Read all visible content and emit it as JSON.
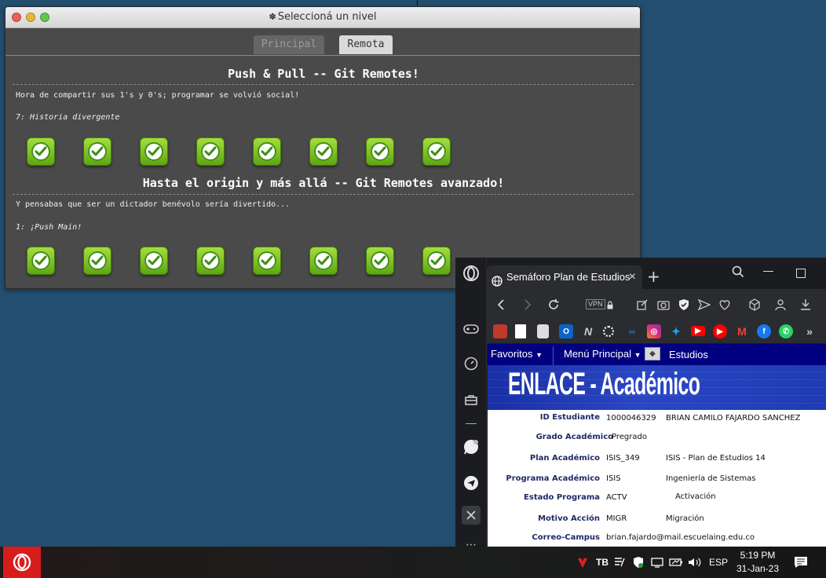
{
  "game": {
    "window_title": "Seleccioná un nivel",
    "tabs": [
      {
        "label": "Principal"
      },
      {
        "label": "Remota"
      }
    ],
    "sections": [
      {
        "title": "Push & Pull -- Git Remotes!",
        "description": "Hora de compartir sus 1's y 0's; programar se volvió social!",
        "level_name": "7: Historia divergente",
        "levels_completed": 8
      },
      {
        "title": "Hasta el origin y más allá -- Git Remotes avanzado!",
        "description": "Y pensabas que ser un dictador benévolo sería divertido...",
        "level_name": "1: ¡Push Main!",
        "levels_completed": 8
      }
    ]
  },
  "browser": {
    "tab_title": "Semáforo Plan de Estudios",
    "vpn_label": "VPN",
    "bookmarks": [
      {
        "icon": "crest-icon",
        "color": "#c0392b"
      },
      {
        "icon": "document-icon",
        "color": "#ffffff"
      },
      {
        "icon": "calculator-icon",
        "color": "#dddddd"
      },
      {
        "icon": "outlook-icon",
        "color": "#0a64c8"
      },
      {
        "icon": "n-logo-icon",
        "color": "#cccccc"
      },
      {
        "icon": "circle-dots-icon",
        "color": "#ffffff"
      },
      {
        "icon": "link-icon",
        "color": "#2a6db8"
      },
      {
        "icon": "instagram-icon",
        "color": "#d6249f"
      },
      {
        "icon": "twitter-icon",
        "color": "#1da1f2"
      },
      {
        "icon": "youtube-icon",
        "color": "#ff0000"
      },
      {
        "icon": "youtube-music-icon",
        "color": "#ff0000"
      },
      {
        "icon": "gmail-icon",
        "color": "#ea4335"
      },
      {
        "icon": "facebook-icon",
        "color": "#1877f2"
      },
      {
        "icon": "whatsapp-icon",
        "color": "#25d366"
      }
    ],
    "menu": {
      "favoritos": "Favoritos",
      "menu_principal": "Menú Principal",
      "estudios": "Estudios"
    },
    "banner_title": "ENLACE - Académico",
    "fields": [
      {
        "label": "ID Estudiante",
        "value1": "1000046329",
        "value2": "BRIAN CAMILO FAJARDO SANCHEZ"
      },
      {
        "label": "Grado Académico",
        "value1": "Pregrado",
        "value2": ""
      },
      {
        "label": "Plan Académico",
        "value1": "ISIS_349",
        "value2": "ISIS - Plan de Estudios 14"
      },
      {
        "label": "Programa Académico",
        "value1": "ISIS",
        "value2": "Ingeniería de Sistemas"
      },
      {
        "label": "Estado Programa",
        "value1": "ACTV",
        "value2": "Activación"
      },
      {
        "label": "Motivo Acción",
        "value1": "MIGR",
        "value2": "Migración"
      },
      {
        "label": "Correo-Campus",
        "value1": "brian.fajardo@mail.escuelaing.edu.co",
        "value2": ""
      }
    ]
  },
  "taskbar": {
    "language": "ESP",
    "time": "5:19 PM",
    "date": "31-Jan-23"
  }
}
